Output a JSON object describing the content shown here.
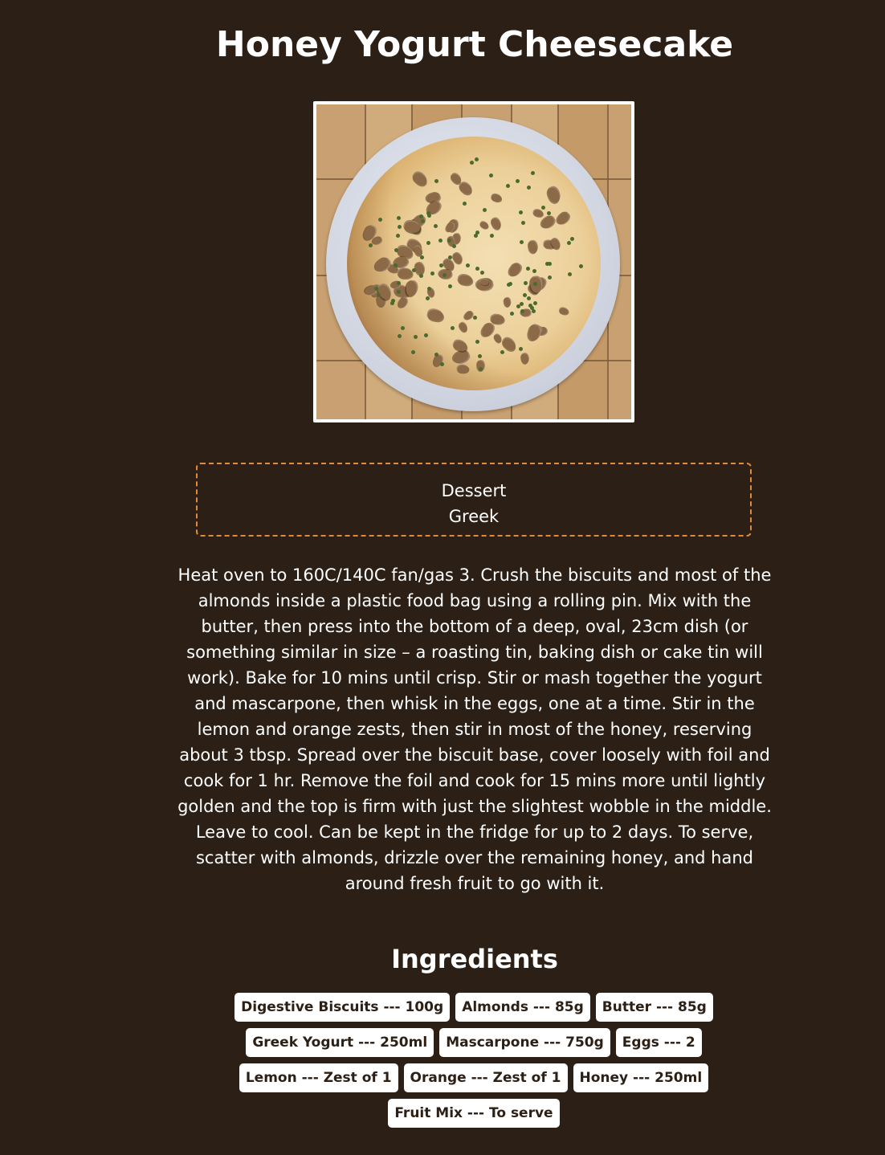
{
  "recipe": {
    "title": "Honey Yogurt Cheesecake",
    "image_alt": "Honey yogurt cheesecake on a white plate",
    "tags": [
      "Dessert",
      "Greek"
    ],
    "instructions": "Heat oven to 160C/140C fan/gas 3. Crush the biscuits and most of the almonds inside a plastic food bag using a rolling pin. Mix with the butter, then press into the bottom of a deep, oval, 23cm dish (or something similar in size – a roasting tin, baking dish or cake tin will work). Bake for 10 mins until crisp. Stir or mash together the yogurt and mascarpone, then whisk in the eggs, one at a time. Stir in the lemon and orange zests, then stir in most of the honey, reserving about 3 tbsp. Spread over the biscuit base, cover loosely with foil and cook for 1 hr. Remove the foil and cook for 15 mins more until lightly golden and the top is firm with just the slightest wobble in the middle. Leave to cool. Can be kept in the fridge for up to 2 days. To serve, scatter with almonds, drizzle over the remaining honey, and hand around fresh fruit to go with it."
  },
  "ingredients_section": {
    "heading": "Ingredients",
    "items": [
      "Digestive Biscuits --- 100g",
      "Almonds --- 85g",
      "Butter --- 85g",
      "Greek Yogurt --- 250ml",
      "Mascarpone --- 750g",
      "Eggs --- 2",
      "Lemon --- Zest of 1",
      "Orange --- Zest of 1",
      "Honey --- 250ml",
      "Fruit Mix --- To serve"
    ]
  },
  "colors": {
    "background": "#2c2016",
    "text": "#ffffff",
    "tag_border": "#e08a3c",
    "pill_background": "#ffffff",
    "pill_text": "#2c2016"
  }
}
